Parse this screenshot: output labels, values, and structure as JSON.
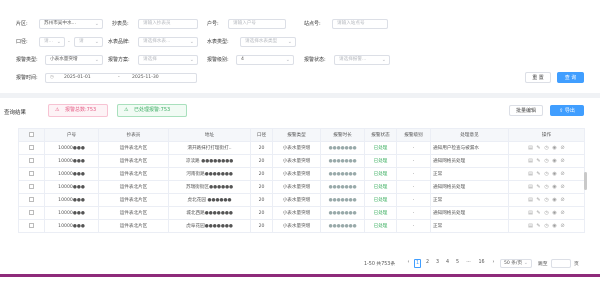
{
  "filters": {
    "district_label": "片区:",
    "district_value": "苏州市吴中水...",
    "meter_reader_label": "抄表员:",
    "meter_reader_placeholder": "请输入抄表员",
    "account_label": "户号:",
    "account_placeholder": "请输入户号",
    "station_label": "站点号:",
    "station_placeholder": "请输入站点号",
    "caliber_label": "口径:",
    "caliber_from": "请...",
    "caliber_to": "请",
    "brand_label": "水表品牌:",
    "brand_placeholder": "请选择水表...",
    "meter_type_label": "水表类型:",
    "meter_type_placeholder": "请选择水表类型",
    "alarm_type_label": "报警类型:",
    "alarm_type_value": "小表水量突增",
    "alarm_scheme_label": "报警方案:",
    "alarm_scheme_placeholder": "请选择",
    "alarm_level_label": "报警级别:",
    "alarm_level_value": "4",
    "alarm_status_label": "报警状态:",
    "alarm_status_placeholder": "请选择报警...",
    "alarm_time_label": "报警时间:",
    "date_start": "2025-01-01",
    "date_separator": "-",
    "date_end": "2025-11-30",
    "reset_label": "重 置",
    "query_label": "查 询"
  },
  "results": {
    "title": "查询结果",
    "total_alarms": "报警总数:753",
    "handled_alarms": "已处理报警:753",
    "batch_edit_label": "批量编辑",
    "export_label": "导出"
  },
  "table": {
    "headers": [
      "",
      "户号",
      "抄表员",
      "地址",
      "口径",
      "报警类型",
      "报警时长",
      "报警状态",
      "报警级别",
      "处理意见",
      "操作"
    ],
    "rows": [
      {
        "account": "10000●●●",
        "reader": "运件表北片区",
        "address": "渭开路抹打打理街打..",
        "caliber": "20",
        "alarm_type": "小表水量突增",
        "duration": "●●●●●●●",
        "status": "已处理",
        "level": "·",
        "opinion": "通知用户检查与被漏水"
      },
      {
        "account": "10000●●●",
        "reader": "运件表北片区",
        "address": "凉渎路 ●●●●●●●●",
        "caliber": "20",
        "alarm_type": "小表水量突增",
        "duration": "●●●●●●●",
        "status": "已处理",
        "level": "·",
        "opinion": "通知网格员处理"
      },
      {
        "account": "10000●●●",
        "reader": "运件表北片区",
        "address": "河南街路●●●●●●●",
        "caliber": "20",
        "alarm_type": "小表水量突增",
        "duration": "●●●●●●●",
        "status": "已处理",
        "level": "·",
        "opinion": "正常"
      },
      {
        "account": "10000●●●",
        "reader": "运件表北片区",
        "address": "苏瑞街街区●●●●●●",
        "caliber": "20",
        "alarm_type": "小表水量突增",
        "duration": "●●●●●●●",
        "status": "已处理",
        "level": "·",
        "opinion": "通知网格员处理"
      },
      {
        "account": "10000●●●",
        "reader": "运件表北片区",
        "address": "虎北花园 ●●●●●●",
        "caliber": "20",
        "alarm_type": "小表水量突增",
        "duration": "●●●●●●●",
        "status": "已处理",
        "level": "·",
        "opinion": "正常"
      },
      {
        "account": "10000●●●",
        "reader": "运件表北片区",
        "address": "城北西路●●●●●●●",
        "caliber": "20",
        "alarm_type": "小表水量突增",
        "duration": "●●●●●●●",
        "status": "已处理",
        "level": "·",
        "opinion": "通知网格员处理"
      },
      {
        "account": "10000●●●",
        "reader": "运件表北片区",
        "address": "虎阜花园●●●●●●●",
        "caliber": "20",
        "alarm_type": "小表水量突增",
        "duration": "●●●●●●●",
        "status": "已处理",
        "level": "·",
        "opinion": "正常"
      }
    ],
    "ops_icons": [
      "document-icon",
      "edit-icon",
      "history-icon",
      "check-circle-icon",
      "delete-icon"
    ]
  },
  "pagination": {
    "range_text": "1-50 共753条",
    "prev": "‹",
    "pages": [
      "1",
      "2",
      "3",
      "4",
      "5",
      "···",
      "16"
    ],
    "next": "›",
    "page_size": "50 条/页",
    "goto_label": "跳至",
    "goto_value": "页"
  },
  "colors": {
    "primary": "#409eff",
    "handled_green": "#3aae5f",
    "accent_bottom": "#8e2a7a"
  }
}
